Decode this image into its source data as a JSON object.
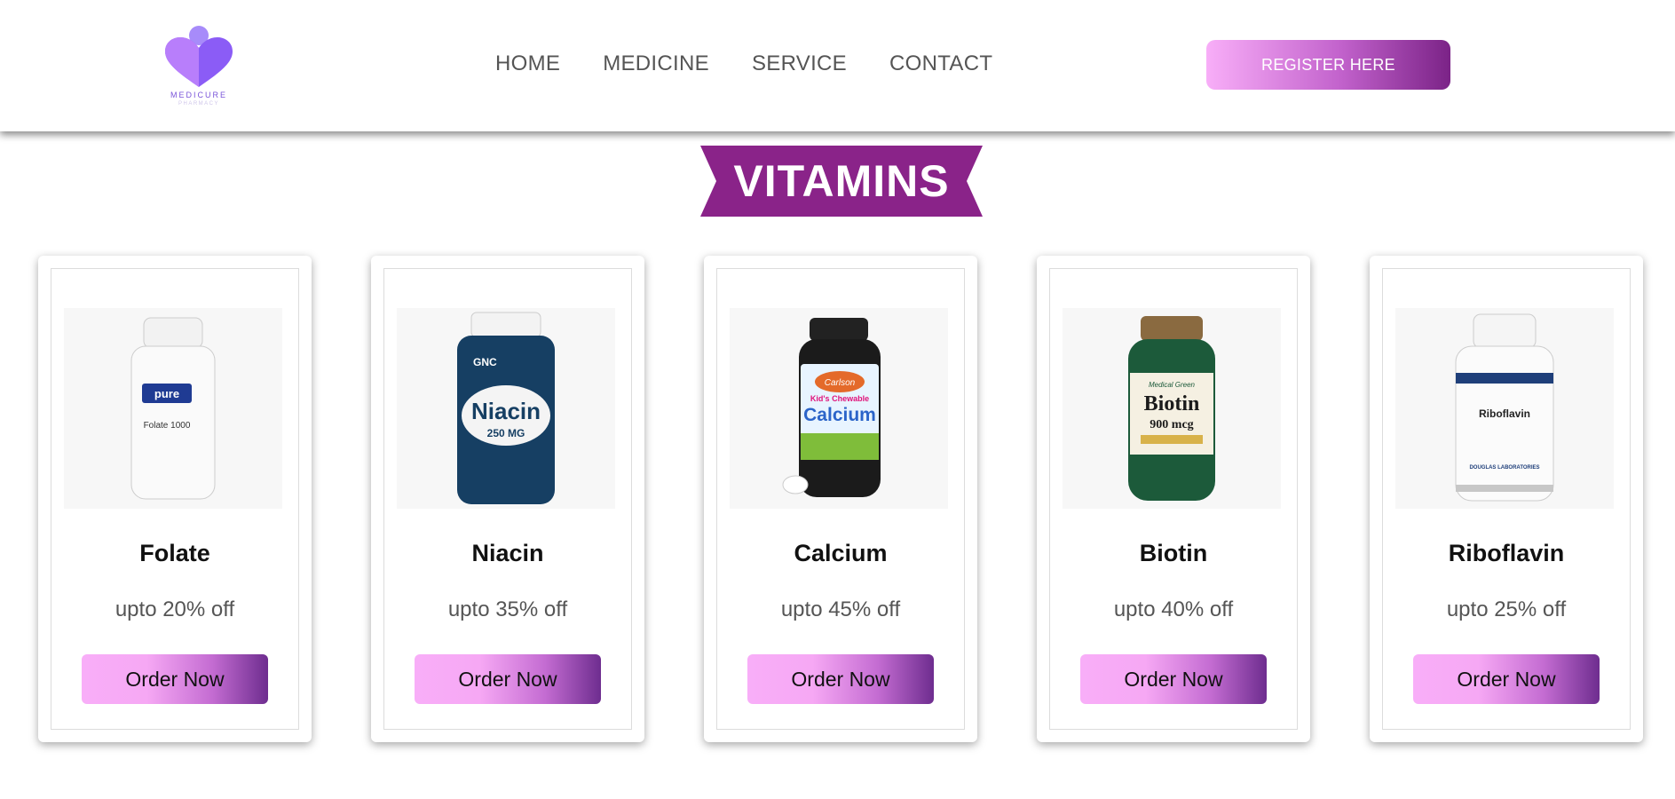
{
  "header": {
    "logo_text": "MEDICURE",
    "logo_subtext": "PHARMACY",
    "nav": [
      {
        "label": "HOME"
      },
      {
        "label": "MEDICINE"
      },
      {
        "label": "SERVICE"
      },
      {
        "label": "CONTACT"
      }
    ],
    "register_label": "REGISTER HERE"
  },
  "section": {
    "title": "VITAMINS"
  },
  "products": [
    {
      "name": "Folate",
      "discount": "upto 20% off",
      "order_label": "Order Now",
      "image": "folate-bottle-icon",
      "label": "Folate 1000",
      "brand": "pure"
    },
    {
      "name": "Niacin",
      "discount": "upto 35% off",
      "order_label": "Order Now",
      "image": "niacin-bottle-icon",
      "label": "Niacin",
      "brand": "GNC",
      "dose": "250 MG"
    },
    {
      "name": "Calcium",
      "discount": "upto 45% off",
      "order_label": "Order Now",
      "image": "calcium-bottle-icon",
      "label": "Calcium",
      "brand": "Carlson",
      "tagline": "Kid's Chewable"
    },
    {
      "name": "Biotin",
      "discount": "upto 40% off",
      "order_label": "Order Now",
      "image": "biotin-bottle-icon",
      "label": "Biotin",
      "brand": "Medical Green",
      "dose": "900 mcg"
    },
    {
      "name": "Riboflavin",
      "discount": "upto 25% off",
      "order_label": "Order Now",
      "image": "riboflavin-bottle-icon",
      "label": "Riboflavin",
      "brand": "DOUGLAS LABORATORIES"
    }
  ],
  "colors": {
    "brand_purple": "#8a2389",
    "button_gradient_start": "#f8aef8",
    "button_gradient_end": "#6e2d8f",
    "logo_purple": "#8b5cf6"
  }
}
